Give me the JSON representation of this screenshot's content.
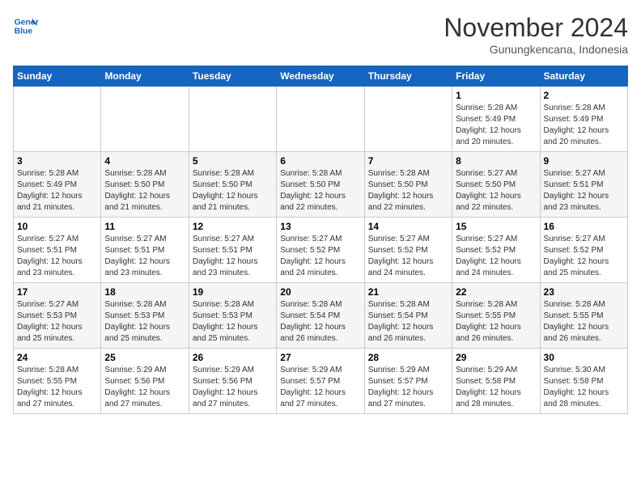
{
  "logo": {
    "line1": "General",
    "line2": "Blue"
  },
  "title": "November 2024",
  "subtitle": "Gunungkencana, Indonesia",
  "weekdays": [
    "Sunday",
    "Monday",
    "Tuesday",
    "Wednesday",
    "Thursday",
    "Friday",
    "Saturday"
  ],
  "weeks": [
    [
      {
        "day": "",
        "sunrise": "",
        "sunset": "",
        "daylight": ""
      },
      {
        "day": "",
        "sunrise": "",
        "sunset": "",
        "daylight": ""
      },
      {
        "day": "",
        "sunrise": "",
        "sunset": "",
        "daylight": ""
      },
      {
        "day": "",
        "sunrise": "",
        "sunset": "",
        "daylight": ""
      },
      {
        "day": "",
        "sunrise": "",
        "sunset": "",
        "daylight": ""
      },
      {
        "day": "1",
        "sunrise": "Sunrise: 5:28 AM",
        "sunset": "Sunset: 5:49 PM",
        "daylight": "Daylight: 12 hours and 20 minutes."
      },
      {
        "day": "2",
        "sunrise": "Sunrise: 5:28 AM",
        "sunset": "Sunset: 5:49 PM",
        "daylight": "Daylight: 12 hours and 20 minutes."
      }
    ],
    [
      {
        "day": "3",
        "sunrise": "Sunrise: 5:28 AM",
        "sunset": "Sunset: 5:49 PM",
        "daylight": "Daylight: 12 hours and 21 minutes."
      },
      {
        "day": "4",
        "sunrise": "Sunrise: 5:28 AM",
        "sunset": "Sunset: 5:50 PM",
        "daylight": "Daylight: 12 hours and 21 minutes."
      },
      {
        "day": "5",
        "sunrise": "Sunrise: 5:28 AM",
        "sunset": "Sunset: 5:50 PM",
        "daylight": "Daylight: 12 hours and 21 minutes."
      },
      {
        "day": "6",
        "sunrise": "Sunrise: 5:28 AM",
        "sunset": "Sunset: 5:50 PM",
        "daylight": "Daylight: 12 hours and 22 minutes."
      },
      {
        "day": "7",
        "sunrise": "Sunrise: 5:28 AM",
        "sunset": "Sunset: 5:50 PM",
        "daylight": "Daylight: 12 hours and 22 minutes."
      },
      {
        "day": "8",
        "sunrise": "Sunrise: 5:27 AM",
        "sunset": "Sunset: 5:50 PM",
        "daylight": "Daylight: 12 hours and 22 minutes."
      },
      {
        "day": "9",
        "sunrise": "Sunrise: 5:27 AM",
        "sunset": "Sunset: 5:51 PM",
        "daylight": "Daylight: 12 hours and 23 minutes."
      }
    ],
    [
      {
        "day": "10",
        "sunrise": "Sunrise: 5:27 AM",
        "sunset": "Sunset: 5:51 PM",
        "daylight": "Daylight: 12 hours and 23 minutes."
      },
      {
        "day": "11",
        "sunrise": "Sunrise: 5:27 AM",
        "sunset": "Sunset: 5:51 PM",
        "daylight": "Daylight: 12 hours and 23 minutes."
      },
      {
        "day": "12",
        "sunrise": "Sunrise: 5:27 AM",
        "sunset": "Sunset: 5:51 PM",
        "daylight": "Daylight: 12 hours and 23 minutes."
      },
      {
        "day": "13",
        "sunrise": "Sunrise: 5:27 AM",
        "sunset": "Sunset: 5:52 PM",
        "daylight": "Daylight: 12 hours and 24 minutes."
      },
      {
        "day": "14",
        "sunrise": "Sunrise: 5:27 AM",
        "sunset": "Sunset: 5:52 PM",
        "daylight": "Daylight: 12 hours and 24 minutes."
      },
      {
        "day": "15",
        "sunrise": "Sunrise: 5:27 AM",
        "sunset": "Sunset: 5:52 PM",
        "daylight": "Daylight: 12 hours and 24 minutes."
      },
      {
        "day": "16",
        "sunrise": "Sunrise: 5:27 AM",
        "sunset": "Sunset: 5:52 PM",
        "daylight": "Daylight: 12 hours and 25 minutes."
      }
    ],
    [
      {
        "day": "17",
        "sunrise": "Sunrise: 5:27 AM",
        "sunset": "Sunset: 5:53 PM",
        "daylight": "Daylight: 12 hours and 25 minutes."
      },
      {
        "day": "18",
        "sunrise": "Sunrise: 5:28 AM",
        "sunset": "Sunset: 5:53 PM",
        "daylight": "Daylight: 12 hours and 25 minutes."
      },
      {
        "day": "19",
        "sunrise": "Sunrise: 5:28 AM",
        "sunset": "Sunset: 5:53 PM",
        "daylight": "Daylight: 12 hours and 25 minutes."
      },
      {
        "day": "20",
        "sunrise": "Sunrise: 5:28 AM",
        "sunset": "Sunset: 5:54 PM",
        "daylight": "Daylight: 12 hours and 26 minutes."
      },
      {
        "day": "21",
        "sunrise": "Sunrise: 5:28 AM",
        "sunset": "Sunset: 5:54 PM",
        "daylight": "Daylight: 12 hours and 26 minutes."
      },
      {
        "day": "22",
        "sunrise": "Sunrise: 5:28 AM",
        "sunset": "Sunset: 5:55 PM",
        "daylight": "Daylight: 12 hours and 26 minutes."
      },
      {
        "day": "23",
        "sunrise": "Sunrise: 5:28 AM",
        "sunset": "Sunset: 5:55 PM",
        "daylight": "Daylight: 12 hours and 26 minutes."
      }
    ],
    [
      {
        "day": "24",
        "sunrise": "Sunrise: 5:28 AM",
        "sunset": "Sunset: 5:55 PM",
        "daylight": "Daylight: 12 hours and 27 minutes."
      },
      {
        "day": "25",
        "sunrise": "Sunrise: 5:29 AM",
        "sunset": "Sunset: 5:56 PM",
        "daylight": "Daylight: 12 hours and 27 minutes."
      },
      {
        "day": "26",
        "sunrise": "Sunrise: 5:29 AM",
        "sunset": "Sunset: 5:56 PM",
        "daylight": "Daylight: 12 hours and 27 minutes."
      },
      {
        "day": "27",
        "sunrise": "Sunrise: 5:29 AM",
        "sunset": "Sunset: 5:57 PM",
        "daylight": "Daylight: 12 hours and 27 minutes."
      },
      {
        "day": "28",
        "sunrise": "Sunrise: 5:29 AM",
        "sunset": "Sunset: 5:57 PM",
        "daylight": "Daylight: 12 hours and 27 minutes."
      },
      {
        "day": "29",
        "sunrise": "Sunrise: 5:29 AM",
        "sunset": "Sunset: 5:58 PM",
        "daylight": "Daylight: 12 hours and 28 minutes."
      },
      {
        "day": "30",
        "sunrise": "Sunrise: 5:30 AM",
        "sunset": "Sunset: 5:58 PM",
        "daylight": "Daylight: 12 hours and 28 minutes."
      }
    ]
  ]
}
